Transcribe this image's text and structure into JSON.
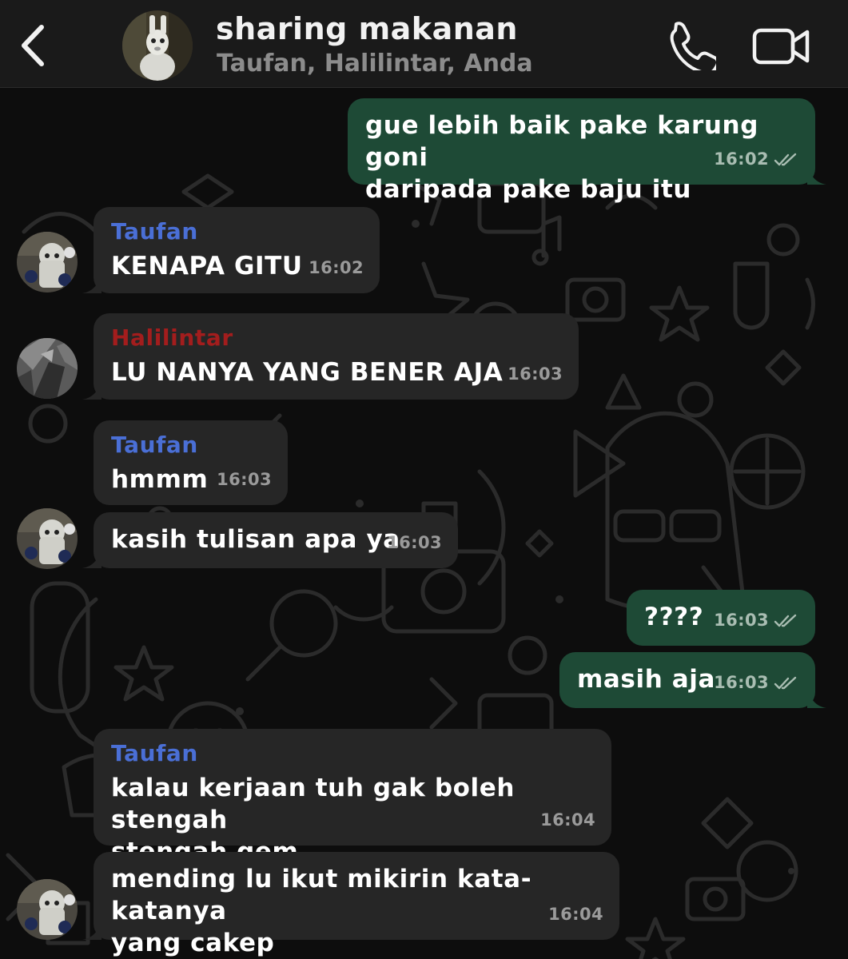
{
  "header": {
    "title": "sharing makanan",
    "subtitle": "Taufan, Halilintar, Anda",
    "back_icon": "chevron-left-icon",
    "call_icon": "phone-icon",
    "video_icon": "video-camera-icon"
  },
  "colors": {
    "header_bg": "#1a1a1a",
    "chat_bg": "#0d0d0d",
    "incoming_bubble": "#262626",
    "outgoing_bubble": "#1e4a36",
    "sender_taufan": "#4a6fd6",
    "sender_halilintar": "#a31d1d"
  },
  "messages": [
    {
      "direction": "outgoing",
      "text": "gue lebih baik pake karung goni\ndaripada pake baju itu",
      "time": "16:02",
      "status": "read"
    },
    {
      "direction": "incoming",
      "sender": "Taufan",
      "text": "KENAPA GITU",
      "time": "16:02"
    },
    {
      "direction": "incoming",
      "sender": "Halilintar",
      "text": "LU NANYA YANG BENER AJA",
      "time": "16:03"
    },
    {
      "direction": "incoming",
      "sender": "Taufan",
      "text": "hmmm",
      "time": "16:03"
    },
    {
      "direction": "incoming",
      "text": "kasih tulisan apa ya",
      "time": "16:03"
    },
    {
      "direction": "outgoing",
      "text": "????",
      "time": "16:03",
      "status": "read"
    },
    {
      "direction": "outgoing",
      "text": "masih aja",
      "time": "16:03",
      "status": "read"
    },
    {
      "direction": "incoming",
      "sender": "Taufan",
      "text": "kalau kerjaan tuh gak boleh stengah\nstengah gem",
      "time": "16:04"
    },
    {
      "direction": "incoming",
      "text": "mending lu ikut mikirin kata-katanya\nyang cakep",
      "time": "16:04"
    }
  ]
}
